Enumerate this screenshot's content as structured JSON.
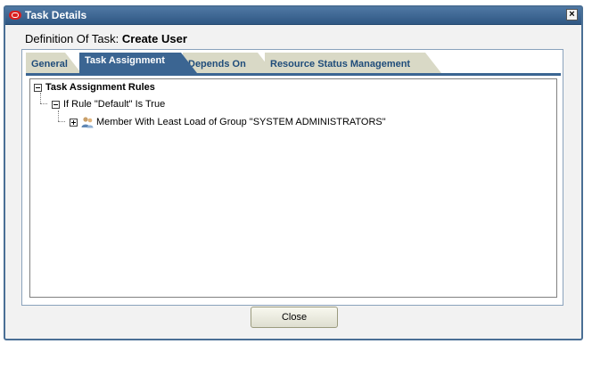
{
  "dialog": {
    "title": "Task Details",
    "heading_prefix": "Definition Of Task:",
    "heading_name": "Create User",
    "close_label": "Close"
  },
  "tabs": [
    {
      "label": "General",
      "active": false
    },
    {
      "label": "Task Assignment",
      "active": true
    },
    {
      "label": "Depends On",
      "active": false
    },
    {
      "label": "Resource Status Management",
      "active": false
    }
  ],
  "tree": {
    "root": "Task Assignment Rules",
    "rule": "If Rule \"Default\" Is True",
    "assignee": "Member With Least Load of Group \"SYSTEM ADMINISTRATORS\""
  },
  "colors": {
    "titlebar": "#3f6894",
    "active_tab": "#3b6592",
    "inactive_tab": "#d9d9c6",
    "app_icon": "#d91f1f"
  },
  "icons": {
    "app": "oracle-logo-icon",
    "close": "close-x-icon",
    "assignee": "user-group-icon"
  }
}
